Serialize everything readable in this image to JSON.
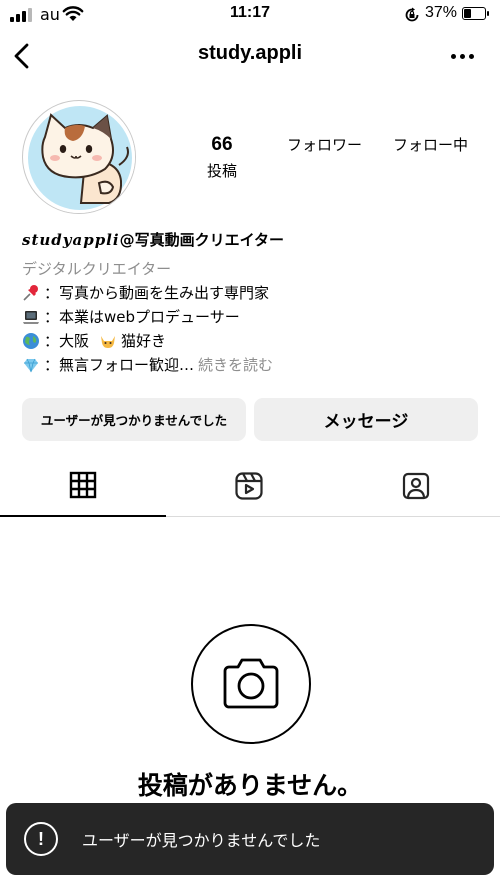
{
  "status_bar": {
    "carrier": "au",
    "time": "11:17",
    "battery_percent": "37%",
    "battery_level": 0.37,
    "icons": [
      "signal-icon",
      "wifi-icon",
      "orientation-lock-icon",
      "battery-icon"
    ]
  },
  "header": {
    "username": "study.appli",
    "icons": [
      "back-chevron-icon",
      "more-options-icon"
    ]
  },
  "profile": {
    "posts_count": "66",
    "posts_label": "投稿",
    "followers_label": "フォロワー",
    "following_label": "フォロー中"
  },
  "bio": {
    "name_script": "studyappli",
    "name_rest": "@写真動画クリエイター",
    "category": "デジタルクリエイター",
    "lines": [
      {
        "icon": "pushpin-icon",
        "text": "：写真から動画を生み出す専門家"
      },
      {
        "icon": "laptop-icon",
        "text": "：本業はwebプロデューサー"
      },
      {
        "icon": "globe-icon",
        "text": "：大阪"
      },
      {
        "icon": "gem-icon",
        "text": "：無言フォロー歓迎…"
      }
    ],
    "line3_suffix": "猫好き",
    "more_label": "続きを読む"
  },
  "buttons": {
    "user_not_found": "ユーザーが見つかりませんでした",
    "message": "メッセージ"
  },
  "tabs": [
    {
      "icon": "grid-icon",
      "active": true
    },
    {
      "icon": "reels-icon",
      "active": false
    },
    {
      "icon": "tagged-icon",
      "active": false
    }
  ],
  "empty_state": {
    "icon": "camera-icon",
    "text": "投稿がありません。"
  },
  "toast": {
    "icon": "alert-icon",
    "icon_glyph": "!",
    "text": "ユーザーが見つかりませんでした"
  }
}
